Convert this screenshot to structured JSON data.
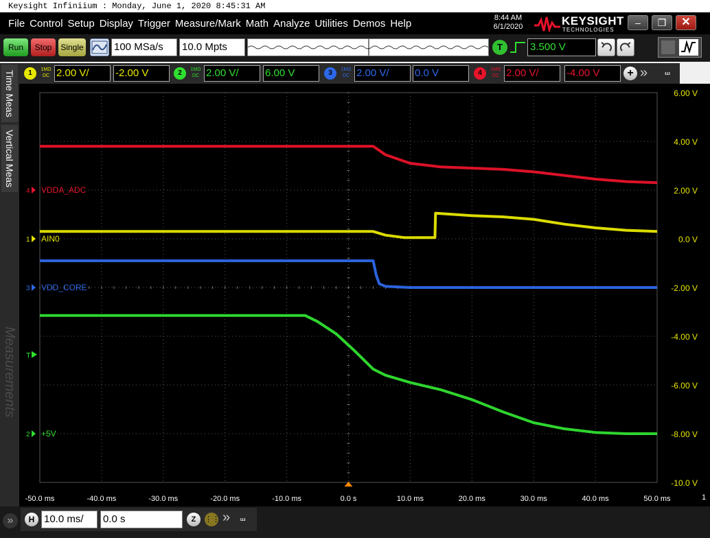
{
  "titlebar": {
    "text": "Keysight Infiniium : Monday, June 1, 2020 8:45:31 AM"
  },
  "menu": [
    "File",
    "Control",
    "Setup",
    "Display",
    "Trigger",
    "Measure/Mark",
    "Math",
    "Analyze",
    "Utilities",
    "Demos",
    "Help"
  ],
  "header": {
    "time": "8:44 AM",
    "date": "6/1/2020",
    "brand": "KEYSIGHT",
    "brand_sub": "TECHNOLOGIES"
  },
  "toolbar": {
    "run": "Run",
    "stop": "Stop",
    "single": "Single",
    "sample_rate": "100 MSa/s",
    "memory_depth": "10.0 Mpts",
    "trigger_badge": "T",
    "trigger_level": "3.500 V"
  },
  "channels": [
    {
      "num": "1",
      "imp": "1MΩ",
      "coupling": "DC",
      "scale": "2.00 V/",
      "offset": "-2.00 V",
      "color": "#e8e800"
    },
    {
      "num": "2",
      "imp": "1MΩ",
      "coupling": "DC",
      "scale": "2.00 V/",
      "offset": "6.00 V",
      "color": "#30e030"
    },
    {
      "num": "3",
      "imp": "1MΩ",
      "coupling": "DC",
      "scale": "2.00 V/",
      "offset": "0.0 V",
      "color": "#2c68e8"
    },
    {
      "num": "4",
      "imp": "1MΩ",
      "coupling": "DC",
      "scale": "2.00 V/",
      "offset": "-4.00 V",
      "color": "#e8132a"
    }
  ],
  "sidetabs": {
    "time_meas": "Time Meas",
    "vertical_meas": "Vertical Meas",
    "measurements": "Measurements"
  },
  "y_ticks": [
    "6.00 V",
    "4.00 V",
    "2.00 V",
    "0.0 V",
    "-2.00 V",
    "-4.00 V",
    "-6.00 V",
    "-8.00 V",
    "-10.0 V"
  ],
  "x_ticks": [
    "-50.0 ms",
    "-40.0 ms",
    "-30.0 ms",
    "-20.0 ms",
    "-10.0 ms",
    "0.0 s",
    "10.0 ms",
    "20.0 ms",
    "30.0 ms",
    "40.0 ms",
    "50.0 ms"
  ],
  "x_axis_edge_label": "1",
  "labels": {
    "ch4": "VDDA_ADC",
    "ch1": "AIN0",
    "ch3": "VDD_CORE",
    "trigger": "T",
    "ch2": "+5V"
  },
  "horizontal": {
    "badge": "H",
    "scale": "10.0 ms/",
    "position": "0.0 s"
  },
  "chart_data": {
    "type": "line",
    "xlabel": "",
    "ylabel": "",
    "xlim": [
      -50,
      50
    ],
    "ylim": [
      -10,
      6
    ],
    "series": [
      {
        "name": "VDDA_ADC",
        "color": "#e8132a",
        "points": [
          [
            -50,
            3.8
          ],
          [
            4,
            3.8
          ],
          [
            6,
            3.45
          ],
          [
            10,
            3.1
          ],
          [
            15,
            2.95
          ],
          [
            20,
            2.9
          ],
          [
            25,
            2.85
          ],
          [
            30,
            2.75
          ],
          [
            35,
            2.6
          ],
          [
            40,
            2.45
          ],
          [
            45,
            2.35
          ],
          [
            50,
            2.3
          ]
        ]
      },
      {
        "name": "AIN0",
        "color": "#e8e800",
        "points": [
          [
            -50,
            0.3
          ],
          [
            4,
            0.3
          ],
          [
            6,
            0.15
          ],
          [
            9,
            0.05
          ],
          [
            14,
            0.05
          ],
          [
            14.1,
            1.05
          ],
          [
            20,
            0.95
          ],
          [
            25,
            0.9
          ],
          [
            30,
            0.8
          ],
          [
            35,
            0.6
          ],
          [
            40,
            0.45
          ],
          [
            45,
            0.35
          ],
          [
            50,
            0.3
          ]
        ]
      },
      {
        "name": "VDD_CORE",
        "color": "#2c68e8",
        "points": [
          [
            -50,
            -0.9
          ],
          [
            4,
            -0.9
          ],
          [
            4.5,
            -1.5
          ],
          [
            5,
            -1.85
          ],
          [
            6,
            -1.95
          ],
          [
            10,
            -2.0
          ],
          [
            50,
            -2.0
          ]
        ]
      },
      {
        "name": "+5V",
        "color": "#30e030",
        "points": [
          [
            -50,
            -3.15
          ],
          [
            -7,
            -3.15
          ],
          [
            -5,
            -3.4
          ],
          [
            -2,
            -3.9
          ],
          [
            1,
            -4.6
          ],
          [
            4,
            -5.35
          ],
          [
            6,
            -5.6
          ],
          [
            10,
            -5.9
          ],
          [
            15,
            -6.2
          ],
          [
            20,
            -6.6
          ],
          [
            25,
            -7.1
          ],
          [
            30,
            -7.55
          ],
          [
            35,
            -7.8
          ],
          [
            40,
            -7.95
          ],
          [
            45,
            -8.0
          ],
          [
            50,
            -8.0
          ]
        ]
      }
    ]
  }
}
